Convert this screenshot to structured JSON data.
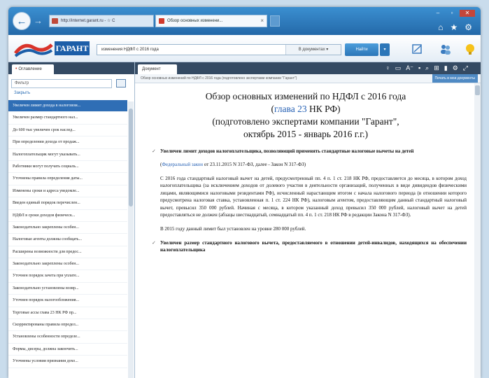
{
  "browser": {
    "address": "http://internet.garant.ru - ☆ C",
    "tab_title": "Обзор основных изменени...",
    "tab_close": "×",
    "back": "←",
    "forward": "→"
  },
  "app": {
    "logo_text": "ГАРАНТ",
    "search_value": "изменения НДФЛ с 2016 года",
    "search_scope": "В документах ▾",
    "find_button": "Найти",
    "find_dropdown": "▾"
  },
  "left_panel": {
    "tab_label": "Оглавление",
    "filter_placeholder": "Фильтр",
    "link_label": "Закрыть",
    "items": [
      "Увеличен лимит дохода в налоговом...",
      "Увеличен размер стандартного нал...",
      "До 600 тыс увеличен срок наслед...",
      "При определении дохода от продаж...",
      "Налогоплательщик могут указывать...",
      "Работники могут получать социаль...",
      "Уточнены правила определения даты...",
      "Изменены сроки и адреса уведомле...",
      "Введен единый порядок перечислен...",
      "НДФЛ в сроки доходов физическ...",
      "Законодательно закреплены особен...",
      "Налоговые агенты должны сообщать...",
      "Расширены возможности для предос...",
      "Законодательно закреплены особен...",
      "Уточнен порядок зачета при уплате...",
      "Законодательно установлены возвр...",
      "Уточнен порядок налогообложения...",
      "Торговые ассы глава 23 НК РФ пр...",
      "Скорректированы правила определ...",
      "Установлены особенности определе...",
      "Формы, дисеры, должна закончить...",
      "Уточнены условия признания дохо..."
    ]
  },
  "right_panel": {
    "tab_label": "Документ",
    "breadcrumb": "Обзор основных изменений по НДФЛ с 2016 года (подготовлено экспертами компании \"Гарант\")",
    "breadcrumb_right": "Печать в мои документы",
    "icons": [
      "♀",
      "▭",
      "A⁻",
      "▪",
      "⌕",
      "⊞",
      "▮",
      "⚙",
      "⤢"
    ]
  },
  "document": {
    "title_line1": "Обзор основных изменений по НДФЛ с 2016 года",
    "title_link": "глава 23",
    "title_after_link": "НК РФ)",
    "title_before_link": "(",
    "title_line3": "(подготовлено экспертами компании \"Гарант\",",
    "title_line4": "октябрь 2015 - январь 2016 г.г.)",
    "section1_heading": "Увеличен лимит доходов налогоплательщика, позволяющий применять стандартные налоговые вычеты на детей",
    "para1_link": "Федеральный закон",
    "para1_text": " от 23.11.2015 N 317-ФЗ, далее - Закон N 317-ФЗ)",
    "para1_open": "(",
    "para2_text": "С 2016 года стандартный налоговый вычет на детей, предусмотренный пп. 4 п. 1 ст. 218 НК РФ, предоставляется до месяца, в котором доход налогоплательщика (за исключением доходов от долевого участия в деятельности организаций, полученных в виде дивидендов физическими лицами, являющимися налоговыми резидентами РФ), исчисленный нарастающим итогом с начала налогового периода (в отношении которого предусмотрена налоговая ставка, установленная п. 1 ст. 224 НК РФ), налоговым агентом, предоставляющим данный стандартный налоговый вычет, превысил 350 000 рублей. Начиная с месяца, в котором указанный доход превысил 350 000 рублей, налоговый вычет на детей предоставляться не должен (абзацы шестнадцатый, семнадцатый пп. 4 п. 1 ст. 218 НК РФ в редакции Закона N 317-ФЗ).",
    "para3_text": "В 2015 году данный лимит был установлен на уровне 280 000 рублей.",
    "section2_heading": "Увеличен размер стандартного налогового вычета, предоставляемого в отношении детей-инвалидов, находящихся на обеспечении налогоплательщика",
    "marker": "✓"
  },
  "colors": {
    "window_frame": "#2a78b9",
    "selected_item": "#2f6eb5",
    "link": "#2560b4",
    "panel_header": "#344a63"
  }
}
